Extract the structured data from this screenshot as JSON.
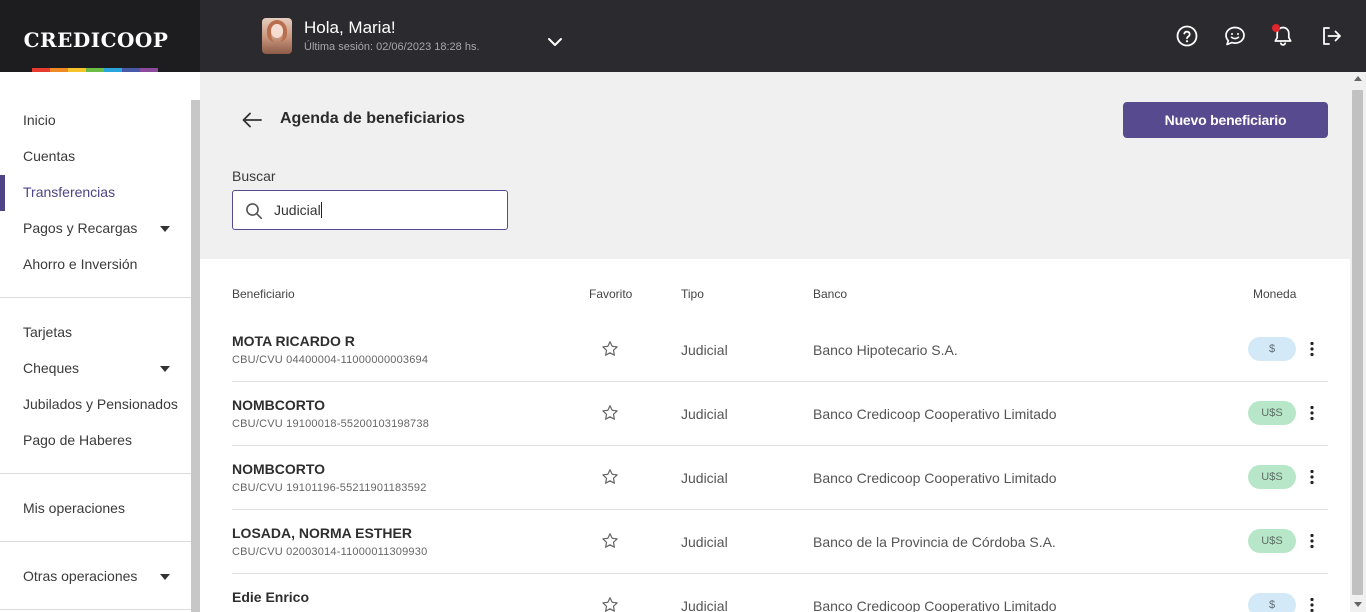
{
  "brand": {
    "logo_text": "CREDICOOP",
    "rainbow_colors": [
      "#e73c2f",
      "#f08a24",
      "#f6c42a",
      "#6cbd45",
      "#2aa6df",
      "#4759a7",
      "#8b4a9c"
    ]
  },
  "header": {
    "greeting": "Hola, Maria!",
    "last_session": "Última sesión: 02/06/2023 18:28 hs.",
    "icons": [
      "help-icon",
      "chat-icon",
      "bell-icon",
      "logout-icon"
    ],
    "has_notification": true
  },
  "sidebar": {
    "items": [
      {
        "label": "Inicio",
        "expandable": false
      },
      {
        "label": "Cuentas",
        "expandable": false
      },
      {
        "label": "Transferencias",
        "expandable": false,
        "active": true
      },
      {
        "label": "Pagos y Recargas",
        "expandable": true
      },
      {
        "label": "Ahorro e Inversión",
        "expandable": false
      },
      {
        "label": "Tarjetas",
        "expandable": false
      },
      {
        "label": "Cheques",
        "expandable": true
      },
      {
        "label": "Jubilados y Pensionados",
        "expandable": false
      },
      {
        "label": "Pago de Haberes",
        "expandable": false
      },
      {
        "label": "Mis operaciones",
        "expandable": false
      },
      {
        "label": "Otras operaciones",
        "expandable": true
      }
    ]
  },
  "main": {
    "title": "Agenda de beneficiarios",
    "new_button": "Nuevo beneficiario",
    "search": {
      "label": "Buscar",
      "value": "Judicial"
    },
    "table": {
      "columns": {
        "beneficiario": "Beneficiario",
        "favorito": "Favorito",
        "tipo": "Tipo",
        "banco": "Banco",
        "moneda": "Moneda"
      },
      "rows": [
        {
          "name": "MOTA RICARDO R",
          "cbu": "CBU/CVU 04400004-11000000003694",
          "tipo": "Judicial",
          "banco": "Banco Hipotecario S.A.",
          "moneda": "$",
          "moneda_type": "peso",
          "favorite": false
        },
        {
          "name": "NOMBCORTO",
          "cbu": "CBU/CVU 19100018-55200103198738",
          "tipo": "Judicial",
          "banco": "Banco Credicoop Cooperativo Limitado",
          "moneda": "U$S",
          "moneda_type": "usd",
          "favorite": false
        },
        {
          "name": "NOMBCORTO",
          "cbu": "CBU/CVU 19101196-55211901183592",
          "tipo": "Judicial",
          "banco": "Banco Credicoop Cooperativo Limitado",
          "moneda": "U$S",
          "moneda_type": "usd",
          "favorite": false
        },
        {
          "name": "LOSADA, NORMA ESTHER",
          "cbu": "CBU/CVU 02003014-11000011309930",
          "tipo": "Judicial",
          "banco": "Banco de la Provincia de Córdoba S.A.",
          "moneda": "U$S",
          "moneda_type": "usd",
          "favorite": false
        },
        {
          "name": "Edie Enrico",
          "cbu": "",
          "tipo": "Judicial",
          "banco": "Banco Credicoop Cooperativo Limitado",
          "moneda": "$",
          "moneda_type": "peso",
          "favorite": false
        }
      ]
    }
  },
  "colors": {
    "accent": "#574a8e",
    "topbar": "#2b2a2e",
    "usd_badge": "#b7e6c8",
    "peso_badge": "#d3e9f8",
    "notification": "#e0262b"
  }
}
